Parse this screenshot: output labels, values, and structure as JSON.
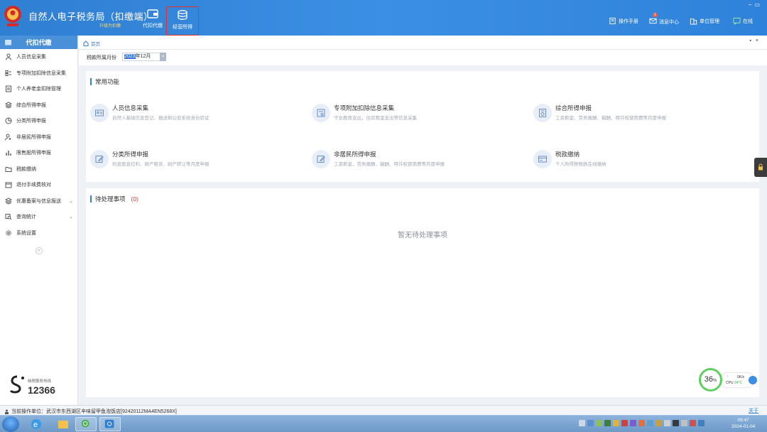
{
  "app": {
    "title": "自然人电子税务局（扣缴端）",
    "subtitle": "升级为扣缴"
  },
  "top_tabs": [
    {
      "label": "代扣代缴",
      "icon": "wallet-icon"
    },
    {
      "label": "经营所得",
      "icon": "stack-icon"
    }
  ],
  "top_right": {
    "manual": "操作手册",
    "messages": "消息中心",
    "messages_badge": "1",
    "unit_mgmt": "单位管理",
    "online": "在线"
  },
  "sidebar": {
    "header": "代扣代缴",
    "items": [
      {
        "label": "人员信息采集",
        "icon": "person-icon"
      },
      {
        "label": "专项附加扣除信息采集",
        "icon": "list-icon"
      },
      {
        "label": "个人养老金扣除管理",
        "icon": "ledger-icon"
      },
      {
        "label": "综合所得申报",
        "icon": "layers-icon"
      },
      {
        "label": "分类所得申报",
        "icon": "pie-icon"
      },
      {
        "label": "非居民所得申报",
        "icon": "person-outline-icon"
      },
      {
        "label": "限售股所得申报",
        "icon": "bar-chart-icon"
      },
      {
        "label": "税款缴纳",
        "icon": "folder-icon"
      },
      {
        "label": "退付手续费核对",
        "icon": "calendar-icon"
      },
      {
        "label": "优惠备案与信息报送",
        "icon": "layers-icon",
        "expandable": true
      },
      {
        "label": "查询统计",
        "icon": "search-icon",
        "expandable": true
      },
      {
        "label": "系统设置",
        "icon": "gear-icon"
      }
    ],
    "hotline_label": "纳税服务热线",
    "hotline_number": "12366"
  },
  "breadcrumb": {
    "home": "首页"
  },
  "period": {
    "label": "税款所属月份",
    "year": "2023",
    "rest": "年12月"
  },
  "common_functions": {
    "title": "常用功能",
    "items": [
      {
        "title": "人员信息采集",
        "desc": "自然人基础信息登记、报送和公安系统身份验证",
        "icon": "id-card-icon"
      },
      {
        "title": "专项附加扣除信息采集",
        "desc": "子女教育支出，住房租金支出等信息采集",
        "icon": "document-icon"
      },
      {
        "title": "综合所得申报",
        "desc": "工资薪金、劳务报酬、稿酬、特许权使用费等月度申报",
        "icon": "report-icon"
      },
      {
        "title": "分类所得申报",
        "desc": "利息股息红利、财产租赁、财产转让等月度申报",
        "icon": "edit-icon"
      },
      {
        "title": "非居民所得申报",
        "desc": "工资薪金、劳务报酬、稿酬、特许权使用费等月度申报",
        "icon": "edit-icon"
      },
      {
        "title": "税款缴纳",
        "desc": "个人所得税税款在线缴纳",
        "icon": "payment-icon"
      }
    ]
  },
  "pending": {
    "title": "待处理事项",
    "count": "(0)",
    "empty_text": "暂无待处理事项"
  },
  "cpu_widget": {
    "percent": "36",
    "percent_unit": "%",
    "speed": "0K/s",
    "cpu_label": "CPU",
    "cpu_temp": "34°C"
  },
  "status_bar": {
    "unit": "当前操作单位：武汉市东西湖区辛味留甲鱼泡饭店[92420112MA4EN5268X]",
    "about": "关于"
  },
  "taskbar": {
    "time": "09:47",
    "date": "2024-01-04"
  },
  "colors": {
    "brand_blue": "#2f7fd3",
    "highlight_red": "#e43030",
    "cpu_green": "#5fcf5f"
  }
}
